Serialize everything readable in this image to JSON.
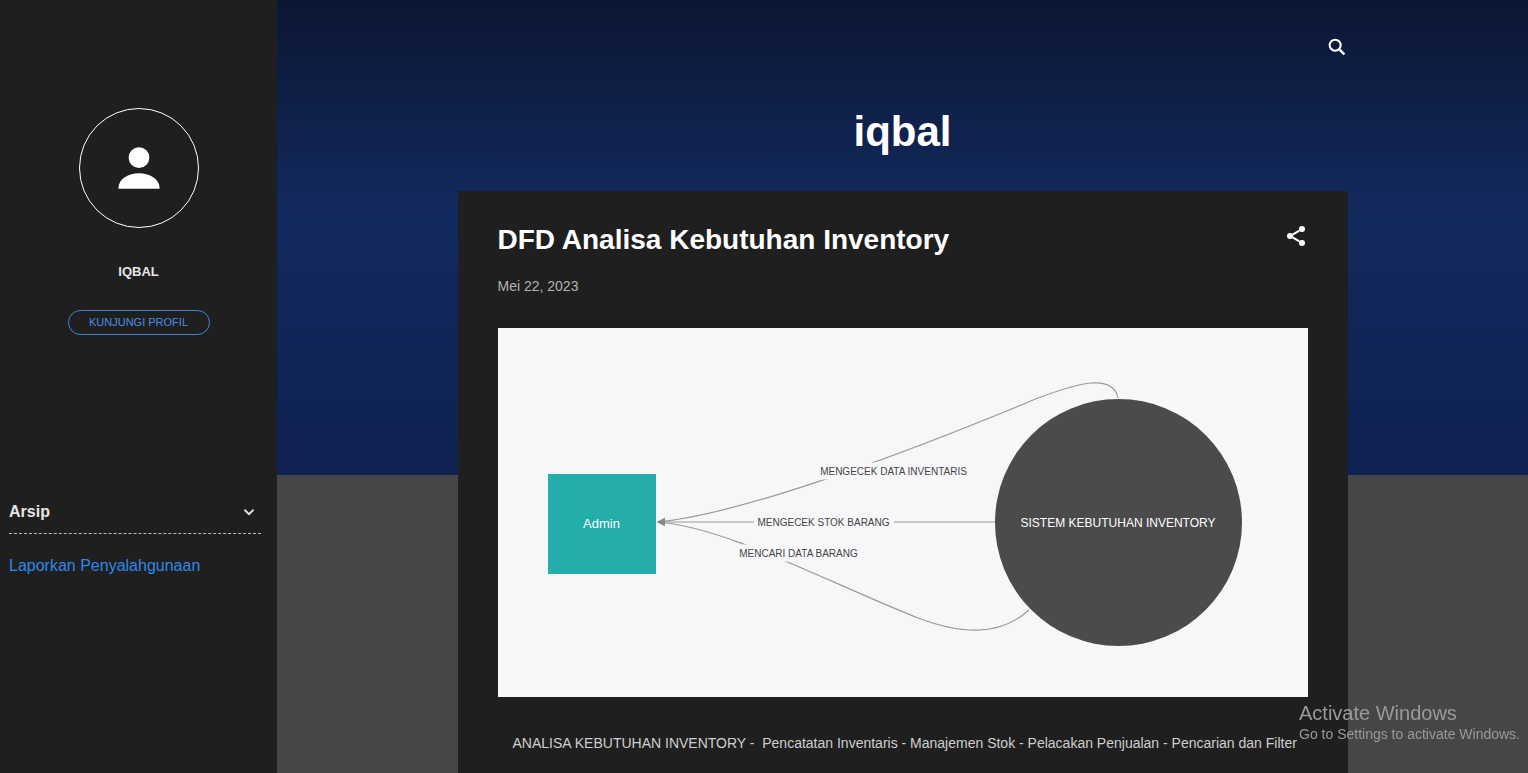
{
  "blog": {
    "title": "iqbal"
  },
  "sidebar": {
    "profile_name": "IQBAL",
    "profile_button": "KUNJUNGI PROFIL",
    "archive": {
      "label": "Arsip",
      "expanded": false
    },
    "report_link": "Laporkan Penyalahgunaan"
  },
  "post": {
    "title": "DFD Analisa Kebutuhan Inventory",
    "date": "Mei 22, 2023",
    "diagram": {
      "nodes": [
        {
          "label": "Admin",
          "kind": "entity"
        },
        {
          "label": "SISTEM KEBUTUHAN INVENTORY",
          "kind": "process"
        }
      ],
      "flows": [
        {
          "label": "MENGECEK DATA INVENTARIS",
          "kind": "upper"
        },
        {
          "label": "MENGECEK STOK BARANG",
          "kind": "straight"
        },
        {
          "label": "MENCARI DATA BARANG",
          "kind": "lower"
        }
      ]
    },
    "body": "ANALISA KEBUTUHAN INVENTORY -  Pencatatan Inventaris - Manajemen Stok - Pelacakan Penjualan - Pencarian dan Filter"
  },
  "watermark": {
    "title": "Activate Windows",
    "subtitle": "Go to Settings to activate Windows."
  }
}
